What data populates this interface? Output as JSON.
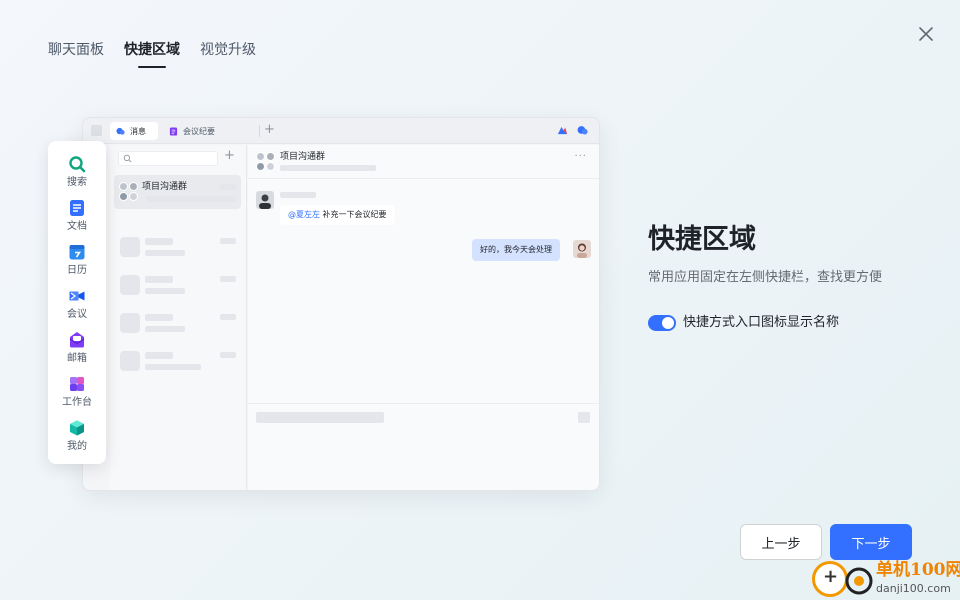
{
  "header": {
    "tabs": [
      {
        "label": "聊天面板",
        "active": false
      },
      {
        "label": "快捷区域",
        "active": true
      },
      {
        "label": "视觉升级",
        "active": false
      }
    ]
  },
  "mock": {
    "window_tabs": [
      "消息",
      "会议纪要"
    ],
    "chat_list": {
      "group_name": "项目沟通群"
    },
    "conversation": {
      "title": "项目沟通群",
      "mention": "@夏左左",
      "left_message": "补充一下会议纪要",
      "right_message": "好的，我今天会处理"
    },
    "quick_bar": [
      {
        "label": "搜索",
        "icon": "search-icon",
        "color": "#11a67e"
      },
      {
        "label": "文档",
        "icon": "doc-icon",
        "color": "#3370ff"
      },
      {
        "label": "日历",
        "icon": "calendar-icon",
        "color": "#2e8cf0"
      },
      {
        "label": "会议",
        "icon": "video-icon",
        "color": "#3370ff"
      },
      {
        "label": "邮箱",
        "icon": "mail-icon",
        "color": "#7f3bf5"
      },
      {
        "label": "工作台",
        "icon": "workplace-icon",
        "color": "#8a4ff5"
      },
      {
        "label": "我的",
        "icon": "cube-icon",
        "color": "#14b8a6"
      }
    ]
  },
  "feature": {
    "title": "快捷区域",
    "description": "常用应用固定在左侧快捷栏，查找更方便",
    "toggle_label": "快捷方式入口图标显示名称",
    "toggle_on": true
  },
  "footer": {
    "prev_label": "上一步",
    "next_label": "下一步"
  },
  "watermark": {
    "line1": "单机100网",
    "line2": "danji100.com"
  },
  "colors": {
    "primary": "#3370ff",
    "text": "#1f2329",
    "secondary_text": "#646a73"
  }
}
